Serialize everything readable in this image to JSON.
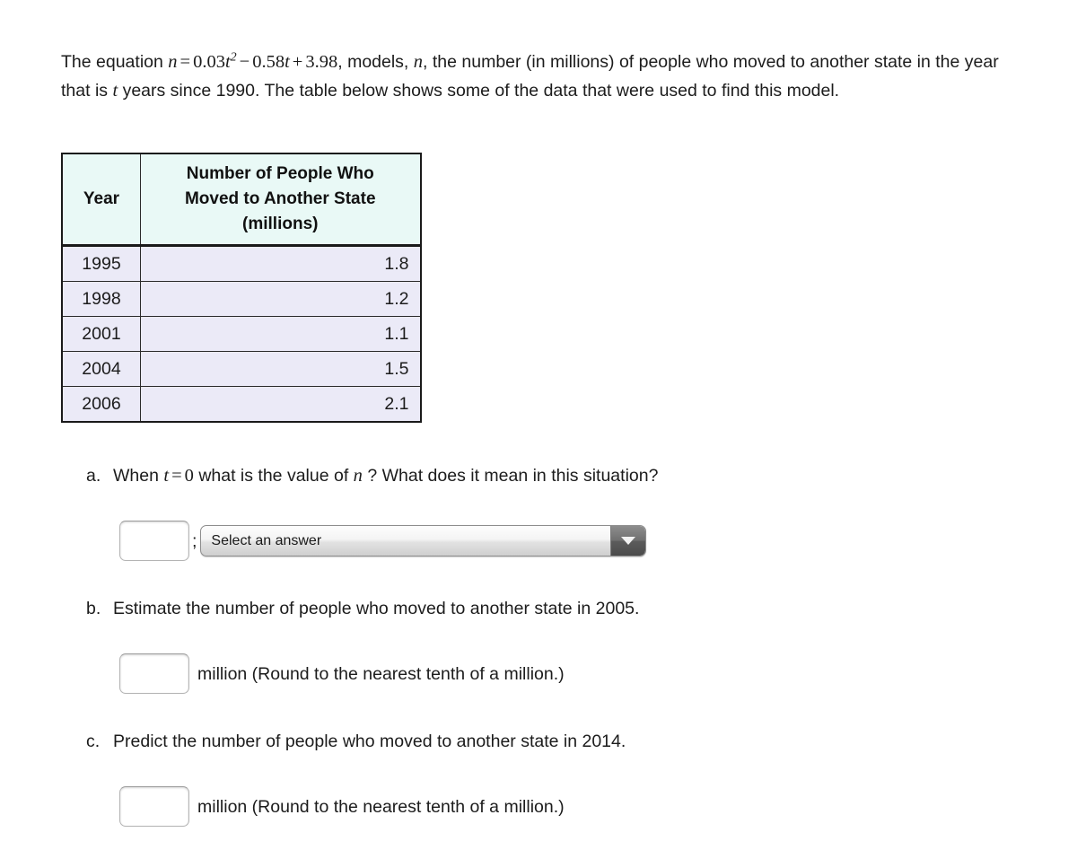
{
  "intro": {
    "lead": "The equation",
    "equation": {
      "lhs": "n",
      "eq": "=",
      "coef_quad": "0.03",
      "var_quad": "t",
      "exponent": "2",
      "minus": "−",
      "coef_lin": "0.58",
      "var_lin": "t",
      "plus": "+",
      "constant": "3.98"
    },
    "after_equation": ", models,",
    "var_n": "n",
    "body_1": ", the number (in millions) of people who moved to another state in the year that is",
    "var_t": "t",
    "body_2": "years since 1990. The table below shows some of the data that were used to find this model."
  },
  "table": {
    "headers": {
      "year": "Year",
      "people_line1": "Number of People Who",
      "people_line2": "Moved to Another State",
      "people_line3": "(millions)"
    },
    "rows": [
      {
        "year": "1995",
        "value": "1.8"
      },
      {
        "year": "1998",
        "value": "1.2"
      },
      {
        "year": "2001",
        "value": "1.1"
      },
      {
        "year": "2004",
        "value": "1.5"
      },
      {
        "year": "2006",
        "value": "2.1"
      }
    ]
  },
  "questions": {
    "a": {
      "marker": "a.",
      "text_1": "When",
      "var_t": "t",
      "eq": "=",
      "zero": "0",
      "text_2": "what is the value of",
      "var_n": "n",
      "text_3": "? What does it mean in this situation?",
      "input_value": "",
      "input_placeholder": "",
      "separator": ";",
      "select_value": "Select an answer",
      "select_options": [
        "Select an answer"
      ]
    },
    "b": {
      "marker": "b.",
      "text": "Estimate the number of people who moved to another state in 2005.",
      "input_value": "",
      "input_placeholder": "",
      "unit": "million (Round to the nearest tenth of a million.)"
    },
    "c": {
      "marker": "c.",
      "text": "Predict the number of people who moved to another state in 2014.",
      "input_value": "",
      "input_placeholder": "",
      "unit": "million (Round to the nearest tenth of a million.)"
    }
  },
  "colors": {
    "page_background": "#ffffff",
    "table_header_background": "#e9f9f6",
    "table_row_background": "#ebeaf7",
    "table_border": "#1a1a1a",
    "text": "#1c1c1c"
  },
  "icons": {
    "select_chevron": "chevron-down-icon"
  }
}
